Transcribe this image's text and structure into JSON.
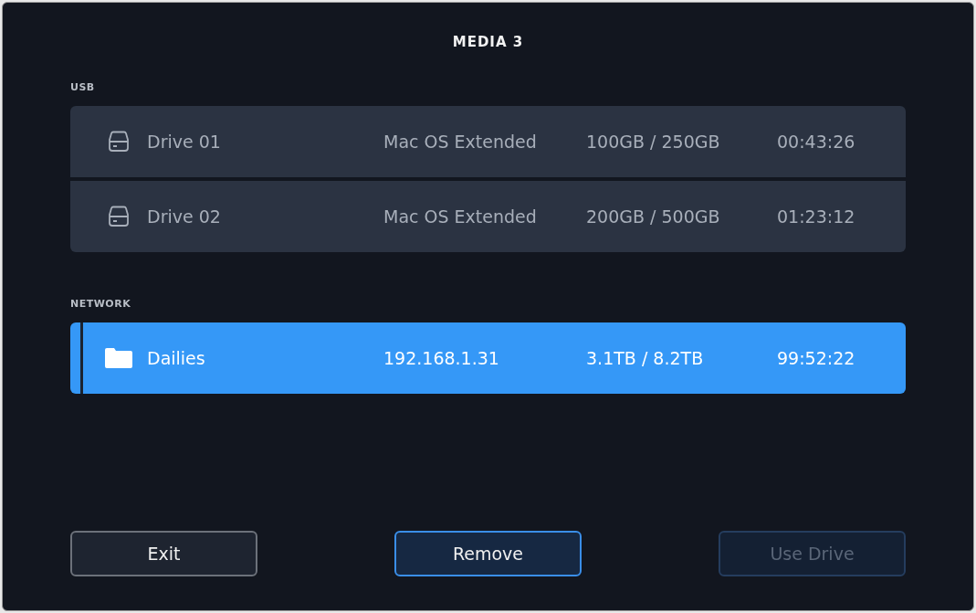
{
  "window": {
    "title": "MEDIA 3"
  },
  "sections": [
    {
      "heading": "USB",
      "rows": [
        {
          "kind": "drive",
          "name": "Drive 01",
          "format": "Mac OS Extended",
          "capacity": "100GB / 250GB",
          "time": "00:43:26",
          "selected": false
        },
        {
          "kind": "drive",
          "name": "Drive 02",
          "format": "Mac OS Extended",
          "capacity": "200GB / 500GB",
          "time": "01:23:12",
          "selected": false
        }
      ]
    },
    {
      "heading": "NETWORK",
      "rows": [
        {
          "kind": "folder",
          "name": "Dailies",
          "format": "192.168.1.31",
          "capacity": "3.1TB / 8.2TB",
          "time": "99:52:22",
          "selected": true
        }
      ]
    }
  ],
  "buttons": [
    {
      "label": "Exit",
      "focused": false,
      "disabled": false
    },
    {
      "label": "Remove",
      "focused": true,
      "disabled": false
    },
    {
      "label": "Use Drive",
      "focused": false,
      "disabled": true
    }
  ]
}
